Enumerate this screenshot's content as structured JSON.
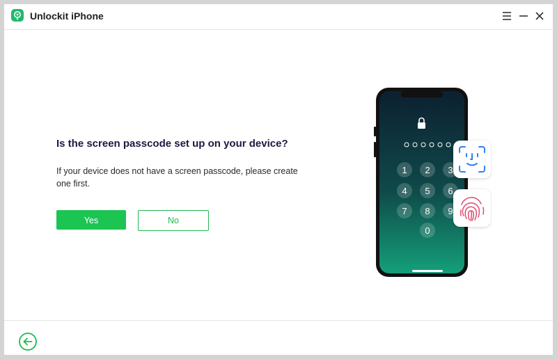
{
  "window": {
    "title": "Unlockit iPhone"
  },
  "titlebar_controls": {
    "menu_icon": "hamburger-menu-icon",
    "minimize_icon": "minimize-icon",
    "close_icon": "close-icon"
  },
  "main": {
    "question": "Is the screen passcode set up on your device?",
    "hint": "If your device does not have a screen passcode, please create one first.",
    "yes_label": "Yes",
    "no_label": "No"
  },
  "phone": {
    "passcode_dots": 6,
    "keypad": [
      "1",
      "2",
      "3",
      "4",
      "5",
      "6",
      "7",
      "8",
      "9",
      "0"
    ],
    "badges": [
      "face-id-icon",
      "fingerprint-icon"
    ]
  },
  "footer": {
    "back_icon": "back-arrow-icon"
  },
  "colors": {
    "accent": "#1cc452",
    "title_text": "#1a1a40",
    "face_id": "#2f80ed",
    "fingerprint": "#e0557a"
  }
}
